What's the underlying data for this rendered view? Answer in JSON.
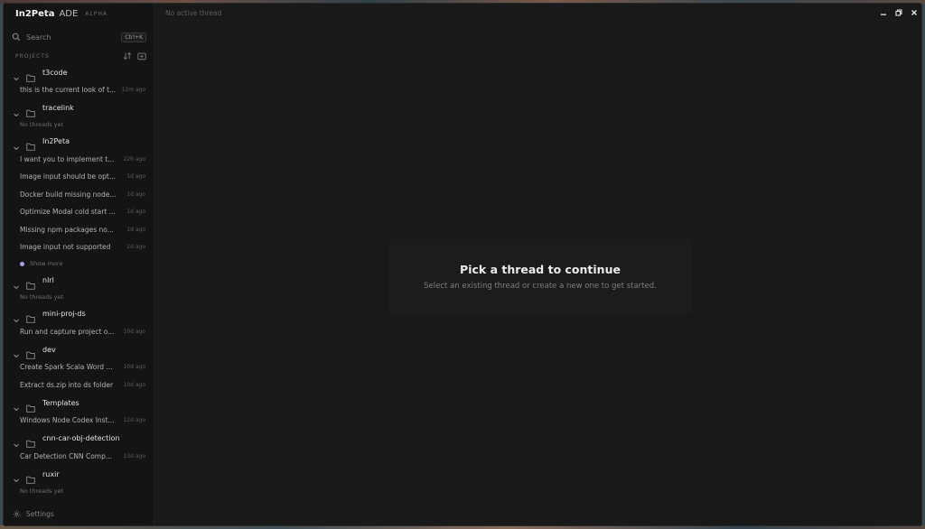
{
  "app": {
    "name": "In2Peta",
    "suffix": "ADE",
    "tag": "ALPHA"
  },
  "search": {
    "label": "Search",
    "shortcut": "Ctrl+K"
  },
  "projects_label": "PROJECTS",
  "projects": [
    {
      "name": "t3code",
      "threads": [
        {
          "title": "this is the current look of t...",
          "time": "12m ago"
        }
      ]
    },
    {
      "name": "tracelink",
      "empty": "No threads yet"
    },
    {
      "name": "In2Peta",
      "threads": [
        {
          "title": "I want you to implement t...",
          "time": "22h ago"
        },
        {
          "title": "Image input should be opt...",
          "time": "1d ago"
        },
        {
          "title": "Docker build missing node...",
          "time": "1d ago"
        },
        {
          "title": "Optimize Modal cold start ...",
          "time": "1d ago"
        },
        {
          "title": "Missing npm packages no...",
          "time": "1d ago"
        },
        {
          "title": "Image input not supported",
          "time": "2d ago"
        }
      ],
      "show_more": "Show more"
    },
    {
      "name": "nlrl",
      "empty": "No threads yet"
    },
    {
      "name": "mini-proj-ds",
      "threads": [
        {
          "title": "Run and capture project o...",
          "time": "10d ago"
        }
      ]
    },
    {
      "name": "dev",
      "threads": [
        {
          "title": "Create Spark Scala Word ...",
          "time": "10d ago"
        },
        {
          "title": "Extract ds.zip into ds folder",
          "time": "10d ago"
        }
      ]
    },
    {
      "name": "Templates",
      "threads": [
        {
          "title": "Windows Node Codex Inst...",
          "time": "12d ago"
        }
      ]
    },
    {
      "name": "cnn-car-obj-detection",
      "threads": [
        {
          "title": "Car Detection CNN Comp...",
          "time": "13d ago"
        }
      ]
    },
    {
      "name": "ruxir",
      "empty": "No threads yet"
    }
  ],
  "settings_label": "Settings",
  "header": {
    "thread_status": "No active thread"
  },
  "empty_state": {
    "title": "Pick a thread to continue",
    "subtitle": "Select an existing thread or create a new one to get started."
  }
}
